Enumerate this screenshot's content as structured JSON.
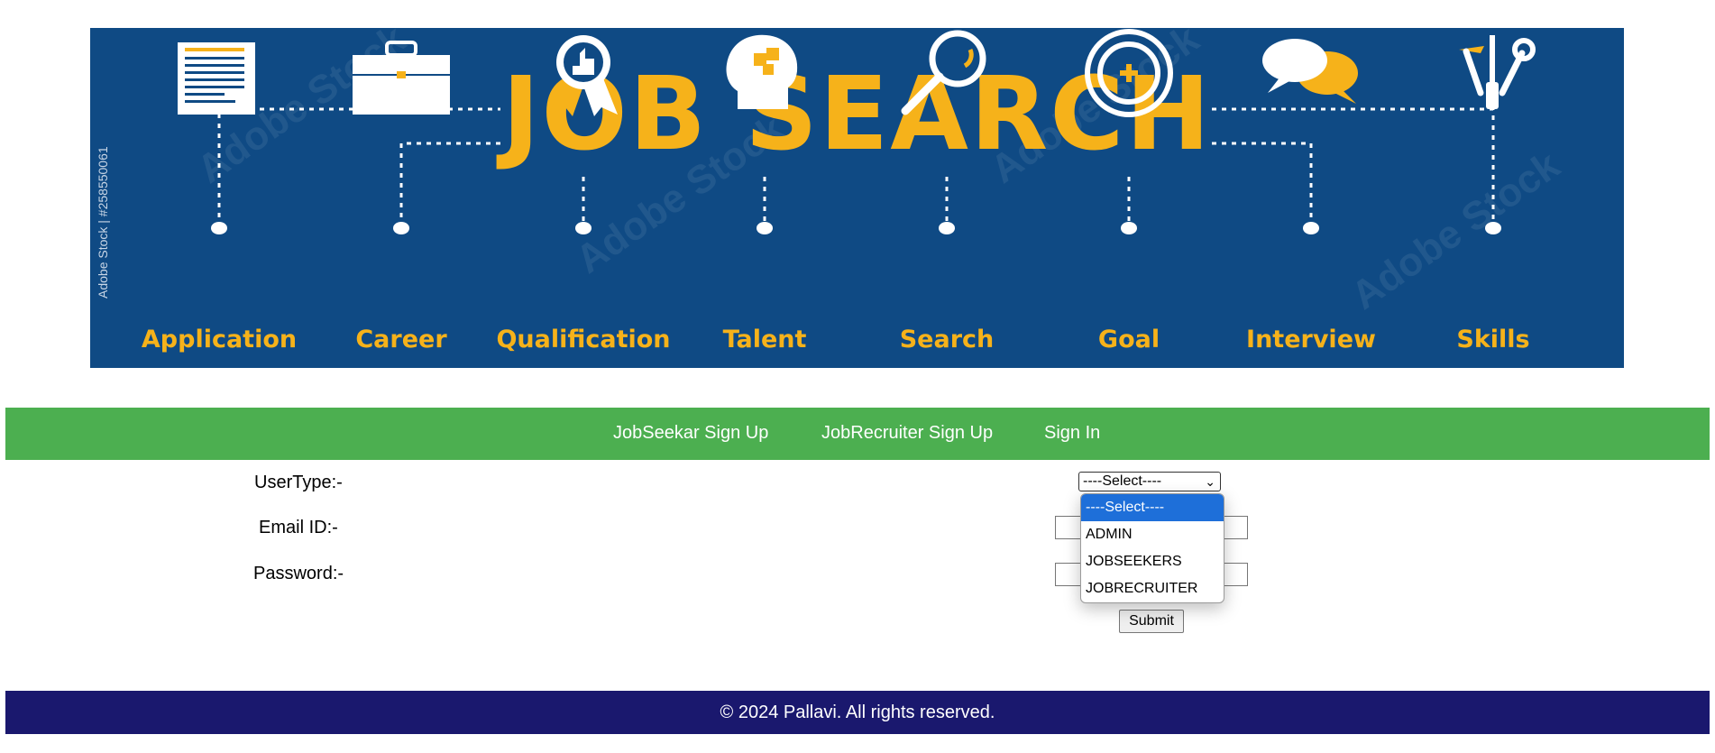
{
  "banner": {
    "title": "JOB SEARCH",
    "stock_id": "Adobe Stock | #258550061",
    "watermark": "Adobe Stock",
    "icons": [
      {
        "label": "Application",
        "icon": "document-icon"
      },
      {
        "label": "Career",
        "icon": "briefcase-icon"
      },
      {
        "label": "Qualification",
        "icon": "award-icon"
      },
      {
        "label": "Talent",
        "icon": "puzzle-head-icon"
      },
      {
        "label": "Search",
        "icon": "magnifier-icon"
      },
      {
        "label": "Goal",
        "icon": "target-icon"
      },
      {
        "label": "Interview",
        "icon": "chat-bubbles-icon"
      },
      {
        "label": "Skills",
        "icon": "tools-icon"
      }
    ]
  },
  "nav": {
    "items": [
      {
        "label": "JobSeekar Sign Up"
      },
      {
        "label": "JobRecruiter Sign Up"
      },
      {
        "label": "Sign In"
      }
    ]
  },
  "form": {
    "usertype_label": "UserType:-",
    "email_label": "Email ID:-",
    "password_label": "Password:-",
    "usertype_value": "----Select----",
    "usertype_options": [
      "----Select----",
      "ADMIN",
      "JOBSEEKERS",
      "JOBRECRUITER"
    ],
    "email_value": "",
    "password_value": "",
    "submit_label": "Submit"
  },
  "footer": {
    "text": "© 2024 Pallavi. All rights reserved."
  },
  "colors": {
    "banner_bg": "#0f4a84",
    "banner_accent": "#f6b21a",
    "nav_bg": "#4caf50",
    "footer_bg": "#1a186e",
    "dropdown_selected": "#1e6fd9"
  }
}
